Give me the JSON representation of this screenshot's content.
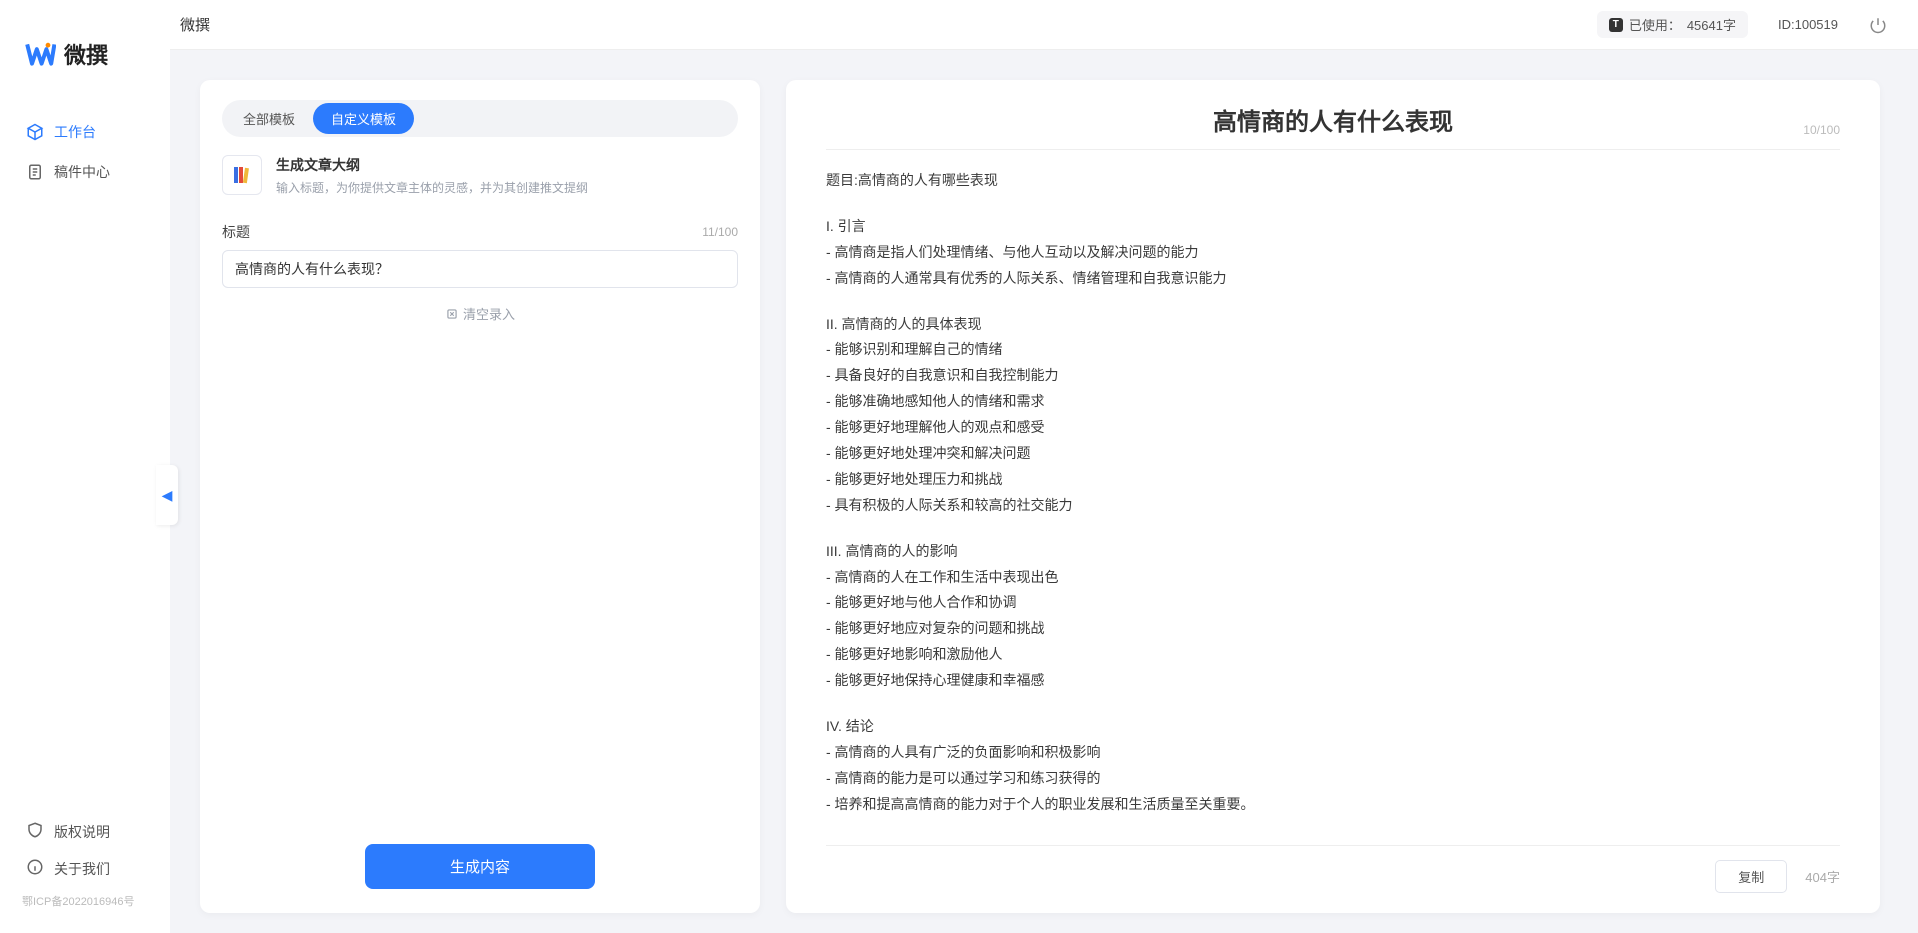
{
  "brand": {
    "name": "微撰"
  },
  "topbar": {
    "title": "微撰",
    "usage_prefix": "已使用：",
    "usage_value": "45641字",
    "id_prefix": "ID:",
    "id_value": "100519"
  },
  "sidebar": {
    "nav": [
      {
        "label": "工作台",
        "active": true,
        "icon": "cube-icon"
      },
      {
        "label": "稿件中心",
        "active": false,
        "icon": "document-icon"
      }
    ],
    "footer": [
      {
        "label": "版权说明",
        "icon": "shield-icon"
      },
      {
        "label": "关于我们",
        "icon": "info-icon"
      }
    ],
    "icp": "鄂ICP备2022016946号"
  },
  "left": {
    "tabs": [
      {
        "label": "全部模板",
        "active": false
      },
      {
        "label": "自定义模板",
        "active": true
      }
    ],
    "template": {
      "title": "生成文章大纲",
      "desc": "输入标题，为你提供文章主体的灵感，并为其创建推文提纲"
    },
    "field": {
      "label": "标题",
      "value": "高情商的人有什么表现？",
      "count": "11/100"
    },
    "clear_label": "清空录入",
    "generate_label": "生成内容"
  },
  "right": {
    "doc_title": "高情商的人有什么表现",
    "title_count": "10/100",
    "heading": "题目:高情商的人有哪些表现",
    "sections": [
      {
        "title": "I. 引言",
        "lines": [
          "- 高情商是指人们处理情绪、与他人互动以及解决问题的能力",
          "- 高情商的人通常具有优秀的人际关系、情绪管理和自我意识能力"
        ]
      },
      {
        "title": "II. 高情商的人的具体表现",
        "lines": [
          "- 能够识别和理解自己的情绪",
          "- 具备良好的自我意识和自我控制能力",
          "- 能够准确地感知他人的情绪和需求",
          "- 能够更好地理解他人的观点和感受",
          "- 能够更好地处理冲突和解决问题",
          "- 能够更好地处理压力和挑战",
          "- 具有积极的人际关系和较高的社交能力"
        ]
      },
      {
        "title": "III. 高情商的人的影响",
        "lines": [
          "- 高情商的人在工作和生活中表现出色",
          "- 能够更好地与他人合作和协调",
          "- 能够更好地应对复杂的问题和挑战",
          "- 能够更好地影响和激励他人",
          "- 能够更好地保持心理健康和幸福感"
        ]
      },
      {
        "title": "IV. 结论",
        "lines": [
          "- 高情商的人具有广泛的负面影响和积极影响",
          "- 高情商的能力是可以通过学习和练习获得的",
          "- 培养和提高高情商的能力对于个人的职业发展和生活质量至关重要。"
        ]
      }
    ],
    "copy_label": "复制",
    "word_count": "404字"
  }
}
